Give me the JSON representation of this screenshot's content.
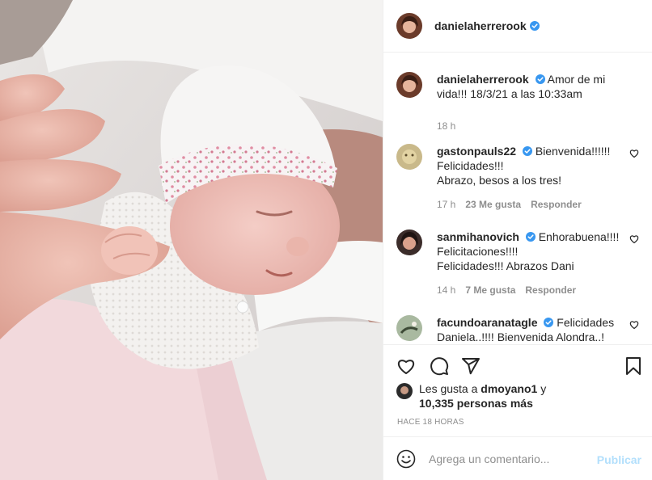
{
  "post": {
    "image_alt": "newborn baby sleeping wearing a white hat with pink floral band, holding an adult's finger"
  },
  "header": {
    "username": "danielaherrerook",
    "avatar_icon": "profile-avatar"
  },
  "caption": {
    "username": "danielaherrerook",
    "text": "Amor de mi vida!!! 18/3/21 a las 10:33am",
    "time": "18 h"
  },
  "comments": [
    {
      "username": "gastonpauls22",
      "text": "Bienvenida!!!!!!\nFelicidades!!!\nAbrazo, besos a los tres!",
      "time": "17 h",
      "likes": "23 Me gusta",
      "reply": "Responder"
    },
    {
      "username": "sanmihanovich",
      "text": "Enhorabuena!!!! Felicitaciones!!!!\nFelicidades!!! Abrazos Dani",
      "time": "14 h",
      "likes": "7 Me gusta",
      "reply": "Responder"
    },
    {
      "username": "facundoaranatagle",
      "text": "Felicidades Daniela..!!!! Bienvenida Alondra..!",
      "time": "",
      "likes": "",
      "reply": ""
    }
  ],
  "actions": {
    "like_icon": "heart-icon",
    "comment_icon": "comment-icon",
    "share_icon": "share-icon",
    "save_icon": "bookmark-icon"
  },
  "likes": {
    "prefix": "Les gusta a",
    "user": "dmoyano1",
    "joiner": "y",
    "count": "10,335 personas más"
  },
  "time_ago": "HACE 18 HORAS",
  "add_comment": {
    "placeholder": "Agrega un comentario...",
    "publish": "Publicar"
  },
  "colors": {
    "verified": "#3897f0",
    "publish_disabled": "#b2dffc",
    "muted": "#8e8e8e",
    "text": "#262626"
  }
}
